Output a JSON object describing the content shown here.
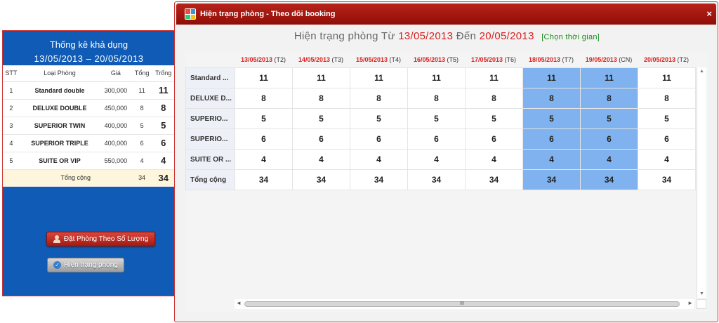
{
  "left": {
    "title": "Thống kê khả dụng",
    "range": "13/05/2013 – 20/05/2013",
    "headers": [
      "STT",
      "Loại Phòng",
      "Giá",
      "Tổng",
      "Trống"
    ],
    "rows": [
      {
        "stt": "1",
        "name": "Standard double",
        "price": "300,000",
        "total": "11",
        "free": "11"
      },
      {
        "stt": "2",
        "name": "DELUXE DOUBLE",
        "price": "450,000",
        "total": "8",
        "free": "8"
      },
      {
        "stt": "3",
        "name": "SUPERIOR TWIN",
        "price": "400,000",
        "total": "5",
        "free": "5"
      },
      {
        "stt": "4",
        "name": "SUPERIOR TRIPLE",
        "price": "400,000",
        "total": "6",
        "free": "6"
      },
      {
        "stt": "5",
        "name": "SUITE OR VIP",
        "price": "550,000",
        "total": "4",
        "free": "4"
      }
    ],
    "total_row": {
      "label": "Tổng cộng",
      "total": "34",
      "free": "34"
    },
    "book_button": "Đặt Phòng Theo Số Lượng",
    "status_button": "Hiện trạng phòng"
  },
  "modal": {
    "title": "Hiện trạng phòng - Theo dõi booking",
    "close": "×",
    "subtitle_prefix": "Hiện trạng phòng Từ",
    "from_date": "13/05/2013",
    "to_word": "Đến",
    "to_date": "20/05/2013",
    "choose_time": "[Chọn thời gian]",
    "columns": [
      {
        "date": "13/05/2013",
        "dow": "(T2)"
      },
      {
        "date": "14/05/2013",
        "dow": "(T3)"
      },
      {
        "date": "15/05/2013",
        "dow": "(T4)"
      },
      {
        "date": "16/05/2013",
        "dow": "(T5)"
      },
      {
        "date": "17/05/2013",
        "dow": "(T6)"
      },
      {
        "date": "18/05/2013",
        "dow": "(T7)"
      },
      {
        "date": "19/05/2013",
        "dow": "(CN)"
      },
      {
        "date": "20/05/2013",
        "dow": "(T2)"
      }
    ],
    "highlight_color": "#7fb2ee",
    "rows": [
      {
        "label": "Standard ...",
        "values": [
          "11",
          "11",
          "11",
          "11",
          "11",
          "11",
          "11",
          "11"
        ]
      },
      {
        "label": "DELUXE D...",
        "values": [
          "8",
          "8",
          "8",
          "8",
          "8",
          "8",
          "8",
          "8"
        ]
      },
      {
        "label": "SUPERIO...",
        "values": [
          "5",
          "5",
          "5",
          "5",
          "5",
          "5",
          "5",
          "5"
        ]
      },
      {
        "label": "SUPERIO...",
        "values": [
          "6",
          "6",
          "6",
          "6",
          "6",
          "6",
          "6",
          "6"
        ]
      },
      {
        "label": "SUITE OR ...",
        "values": [
          "4",
          "4",
          "4",
          "4",
          "4",
          "4",
          "4",
          "4"
        ]
      },
      {
        "label": "Tổng cộng",
        "values": [
          "34",
          "34",
          "34",
          "34",
          "34",
          "34",
          "34",
          "34"
        ]
      }
    ],
    "highlight_columns": [
      5,
      6
    ],
    "scroll_thumb_label": "III"
  }
}
